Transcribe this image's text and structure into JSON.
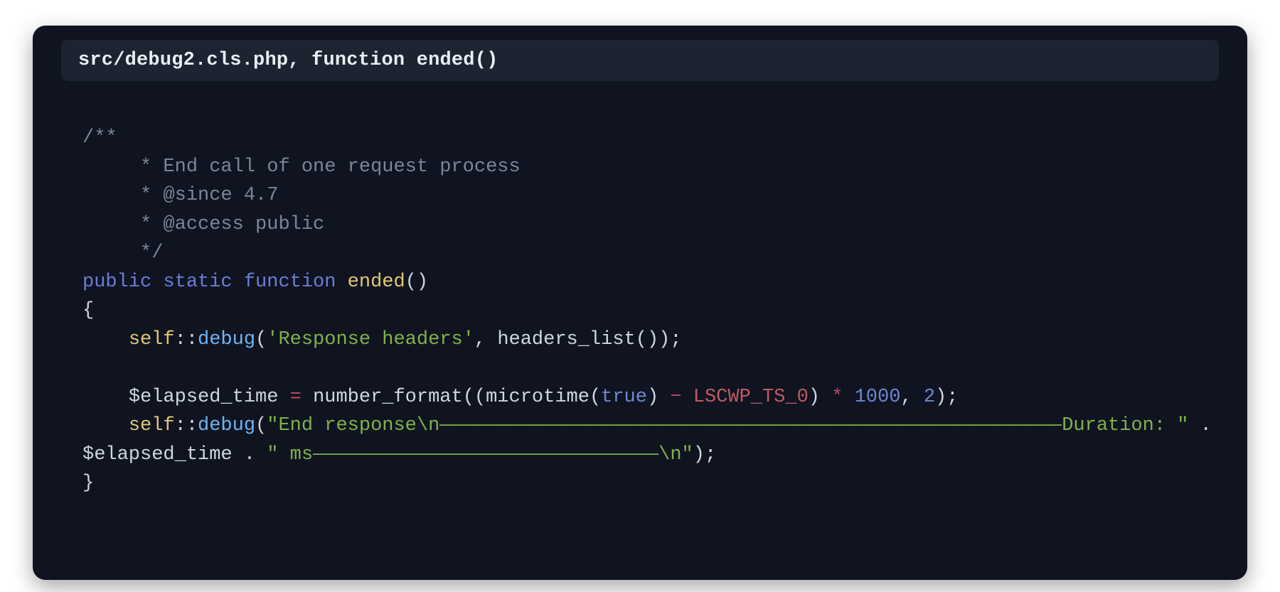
{
  "header": {
    "title": "src/debug2.cls.php, function ended()"
  },
  "code": {
    "c0": "/**",
    "c1": "     * End call of one request process",
    "c2": "     * @since 4.7",
    "c3": "     * @access public",
    "c4": "     */",
    "kw_public": "public",
    "kw_static": "static",
    "kw_function": "function",
    "fn_name": "ended",
    "paren_open": "(",
    "paren_close": ")",
    "brace_open": "{",
    "brace_close": "}",
    "self": "self",
    "scope": "::",
    "m_debug": "debug",
    "str_resp_headers": "'Response headers'",
    "comma": ",",
    "space": " ",
    "headers_list": "headers_list",
    "semi": ";",
    "var_elapsed": "$elapsed_time",
    "assign": "=",
    "number_format": "number_format",
    "microtime": "microtime",
    "true": "true",
    "minus": "−",
    "lscwp": "LSCWP_TS_0",
    "star": "*",
    "n1000": "1000",
    "n2": "2",
    "str_end_resp": "\"End response\\n——————————————————————————————————————————————————————Duration: \"",
    "concat": ".",
    "str_ms": "\" ms——————————————————————————————\\n\"",
    "indent1": "    "
  }
}
